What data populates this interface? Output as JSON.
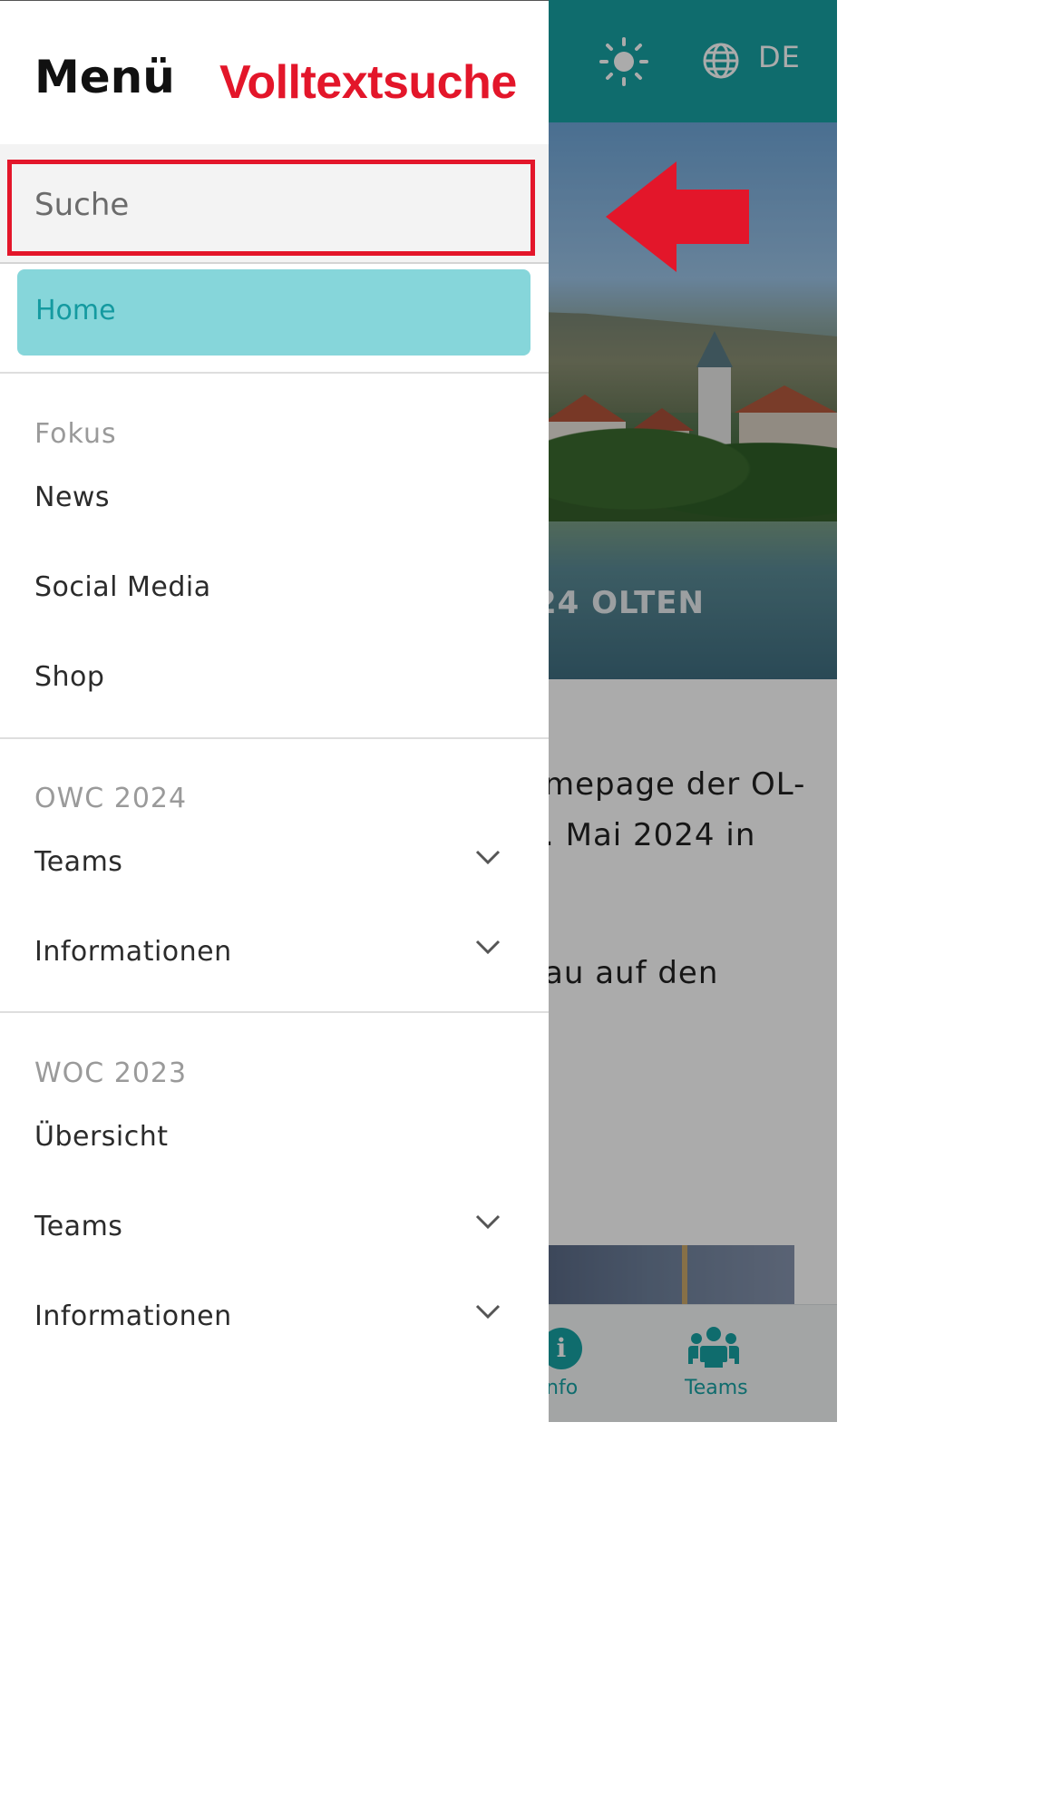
{
  "header": {
    "language": "DE",
    "theme_icon": "sun-icon",
    "language_icon": "globe-icon"
  },
  "hero": {
    "title_fragment": "24 OLTEN"
  },
  "body": {
    "line1": "mepage der OL-",
    "line2": ". Mai 2024 in",
    "line3": "au auf den"
  },
  "tabbar": {
    "info_label": "nfo",
    "teams_label": "Teams",
    "accent": "#17a1a3"
  },
  "drawer": {
    "title": "Menü",
    "search": {
      "placeholder": "Suche",
      "value": ""
    },
    "home": {
      "label": "Home",
      "bg": "#86d6da",
      "text_color": "#149aa0"
    },
    "sections": [
      {
        "title": "Fokus",
        "items": [
          {
            "label": "News"
          },
          {
            "label": "Social Media"
          },
          {
            "label": "Shop"
          }
        ]
      },
      {
        "title": "OWC 2024",
        "items": [
          {
            "label": "Teams",
            "expandable": true
          },
          {
            "label": "Informationen",
            "expandable": true
          }
        ]
      },
      {
        "title": "WOC 2023",
        "items": [
          {
            "label": "Übersicht"
          },
          {
            "label": "Teams",
            "expandable": true
          },
          {
            "label": "Informationen",
            "expandable": true
          }
        ]
      }
    ]
  },
  "annotation": {
    "label": "Volltextsuche",
    "color": "#e3162a"
  }
}
